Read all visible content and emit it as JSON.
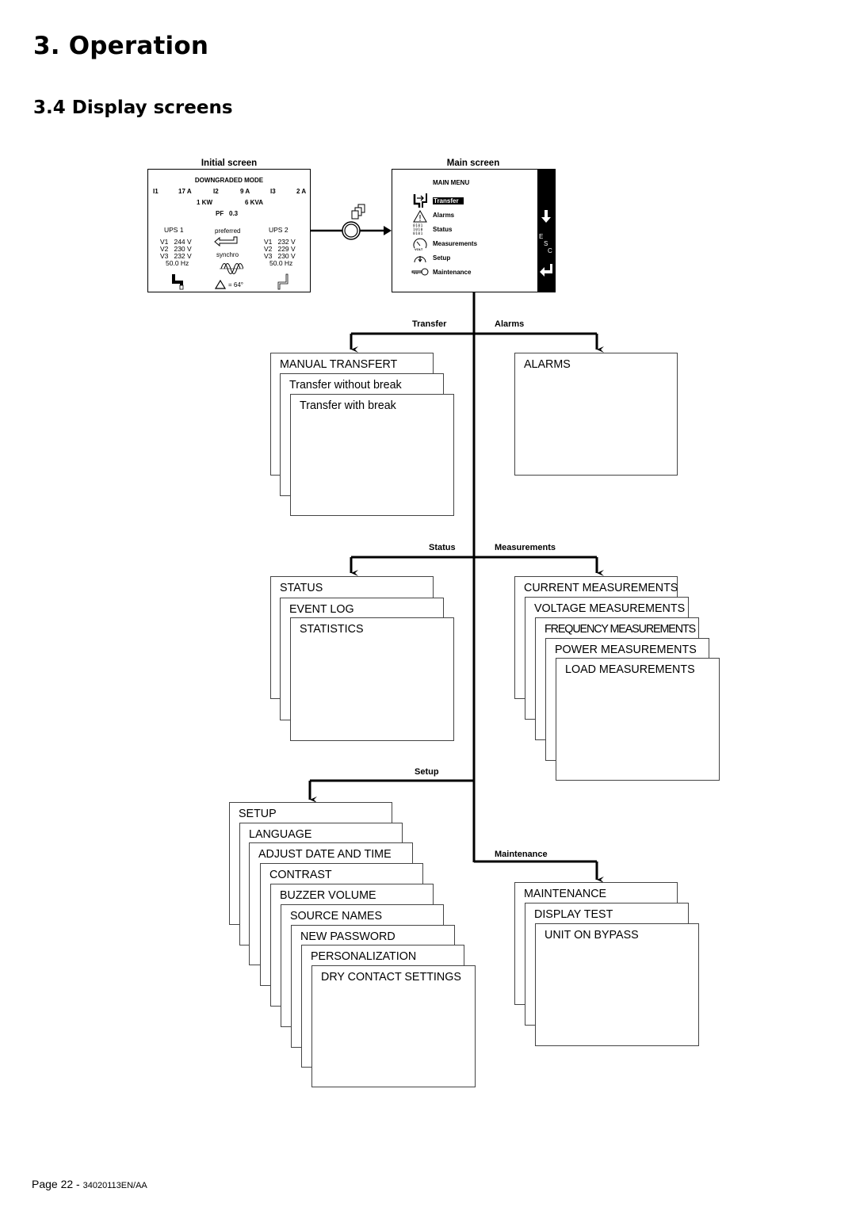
{
  "header": {
    "chapter_title": "3. Operation",
    "section_title": "3.4 Display screens"
  },
  "initial_screen": {
    "caption": "Initial screen",
    "mode": "DOWNGRADED MODE",
    "currents": [
      {
        "label": "I1",
        "value": "17 A"
      },
      {
        "label": "I2",
        "value": "9 A"
      },
      {
        "label": "I3",
        "value": "2 A"
      }
    ],
    "power_kw": "1 KW",
    "power_kva": "6 KVA",
    "pf_label": "PF",
    "pf_value": "0.3",
    "ups1": {
      "name": "UPS 1",
      "v1": "V1   244 V",
      "v2": "V2   230 V",
      "v3": "V3   232 V",
      "freq": "50.0 Hz"
    },
    "ups2": {
      "name": "UPS 2",
      "v1": "V1   232 V",
      "v2": "V2   229 V",
      "v3": "V3   230 V",
      "freq": "50.0 Hz"
    },
    "preferred_label": "preferred",
    "synchro_label": "synchro",
    "phase_shift": "= 64°"
  },
  "main_screen": {
    "caption": "Main screen",
    "menu_title": "MAIN MENU",
    "items": [
      {
        "label": "Transfer",
        "icon": "transfer-icon",
        "selected": true
      },
      {
        "label": "Alarms",
        "icon": "warning-triangle-icon",
        "selected": false
      },
      {
        "label": "Status",
        "icon": "binary-status-icon",
        "selected": false
      },
      {
        "label": "Measurements",
        "icon": "voltmeter-icon",
        "selected": false
      },
      {
        "label": "Setup",
        "icon": "setup-gauge-icon",
        "selected": false
      },
      {
        "label": "Maintenance",
        "icon": "key-icon",
        "selected": false
      }
    ],
    "sidebar": {
      "down_icon": "arrow-down-icon",
      "esc_letters": [
        "E",
        "S",
        "C"
      ],
      "enter_icon": "enter-icon"
    }
  },
  "branches": {
    "transfer": {
      "label": "Transfer",
      "screens": [
        "MANUAL TRANSFERT",
        "Transfer without break",
        "Transfer with break"
      ]
    },
    "alarms": {
      "label": "Alarms",
      "screens": [
        "ALARMS"
      ]
    },
    "status": {
      "label": "Status",
      "screens": [
        "STATUS",
        "EVENT LOG",
        "STATISTICS"
      ]
    },
    "measurements": {
      "label": "Measurements",
      "screens": [
        "CURRENT MEASUREMENTS",
        "VOLTAGE MEASUREMENTS",
        "FREQUENCY MEASUREMENTS",
        "POWER MEASUREMENTS",
        "LOAD MEASUREMENTS"
      ]
    },
    "setup": {
      "label": "Setup",
      "screens": [
        "SETUP",
        "LANGUAGE",
        "ADJUST DATE AND TIME",
        "CONTRAST",
        "BUZZER VOLUME",
        "SOURCE NAMES",
        "NEW PASSWORD",
        "PERSONALIZATION",
        "DRY CONTACT SETTINGS"
      ]
    },
    "maintenance": {
      "label": "Maintenance",
      "screens": [
        "MAINTENANCE",
        "DISPLAY TEST",
        "UNIT ON BYPASS"
      ]
    }
  },
  "footer": {
    "page": "Page 22 - ",
    "doc_ref": "34020113EN/AA"
  }
}
